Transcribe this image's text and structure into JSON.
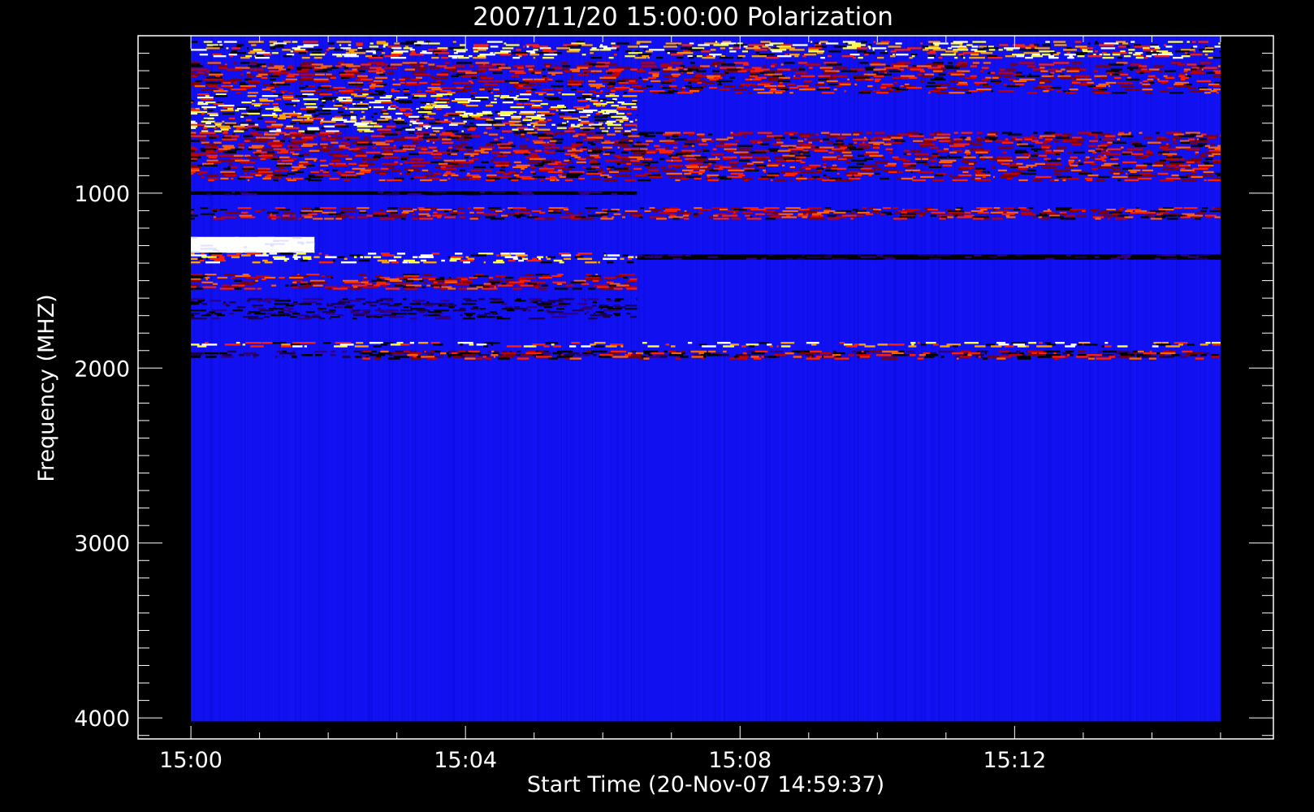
{
  "chart_data": {
    "type": "heatmap",
    "title": "2007/11/20 15:00:00 Polarization",
    "xlabel": "Start Time (20-Nov-07 14:59:37)",
    "ylabel": "Frequency (MHZ)",
    "x_ticks": [
      {
        "label": "15:00",
        "minutes": 0
      },
      {
        "label": "15:04",
        "minutes": 4
      },
      {
        "label": "15:08",
        "minutes": 8
      },
      {
        "label": "15:12",
        "minutes": 12
      }
    ],
    "y_ticks": [
      {
        "label": "1000",
        "value": 1000
      },
      {
        "label": "2000",
        "value": 2000
      },
      {
        "label": "3000",
        "value": 3000
      },
      {
        "label": "4000",
        "value": 4000
      }
    ],
    "xlim_minutes": [
      -0.77,
      15.77
    ],
    "ylim_mhz": [
      4120,
      100
    ],
    "data_extent": {
      "minutes": [
        0,
        15
      ],
      "mhz": [
        100,
        4020
      ]
    },
    "y_reversed": true,
    "grid": false,
    "colors": {
      "background": "#000000",
      "axes": "#ffffff",
      "baseline": "#1010f0",
      "low": "#000000",
      "mid": "#ff2000",
      "high": "#ffff40",
      "max": "#ffffff"
    },
    "features": [
      {
        "name": "rfi-band",
        "mhz": [
          130,
          230
        ],
        "minutes": [
          0,
          15
        ],
        "intensity": "high"
      },
      {
        "name": "rfi-band",
        "mhz": [
          250,
          430
        ],
        "minutes": [
          0,
          15
        ],
        "intensity": "mid"
      },
      {
        "name": "rfi-band",
        "mhz": [
          430,
          650
        ],
        "minutes": [
          0,
          6.5
        ],
        "intensity": "high"
      },
      {
        "name": "rfi-band",
        "mhz": [
          650,
          930
        ],
        "minutes": [
          0,
          15
        ],
        "intensity": "mid"
      },
      {
        "name": "dark-line",
        "mhz": [
          990,
          1010
        ],
        "minutes": [
          0,
          6.5
        ],
        "intensity": "low"
      },
      {
        "name": "speckle-band",
        "mhz": [
          1080,
          1150
        ],
        "minutes": [
          0,
          15
        ],
        "intensity": "mid"
      },
      {
        "name": "saturated-band",
        "mhz": [
          1250,
          1340
        ],
        "minutes": [
          0,
          1.8
        ],
        "intensity": "max"
      },
      {
        "name": "saturated-band",
        "mhz": [
          1340,
          1400
        ],
        "minutes": [
          0,
          6.5
        ],
        "intensity": "high"
      },
      {
        "name": "dark-line",
        "mhz": [
          1350,
          1380
        ],
        "minutes": [
          6.5,
          15
        ],
        "intensity": "low"
      },
      {
        "name": "red-band",
        "mhz": [
          1460,
          1550
        ],
        "minutes": [
          0,
          6.5
        ],
        "intensity": "mid"
      },
      {
        "name": "dark-band",
        "mhz": [
          1600,
          1720
        ],
        "minutes": [
          0,
          6.5
        ],
        "intensity": "low"
      },
      {
        "name": "line-band",
        "mhz": [
          1850,
          1880
        ],
        "minutes": [
          0,
          15
        ],
        "intensity": "high"
      },
      {
        "name": "dark-line",
        "mhz": [
          1900,
          1940
        ],
        "minutes": [
          0,
          15
        ],
        "intensity": "low"
      },
      {
        "name": "red-band",
        "mhz": [
          1900,
          1950
        ],
        "minutes": [
          2.5,
          15
        ],
        "intensity": "mid"
      }
    ]
  }
}
